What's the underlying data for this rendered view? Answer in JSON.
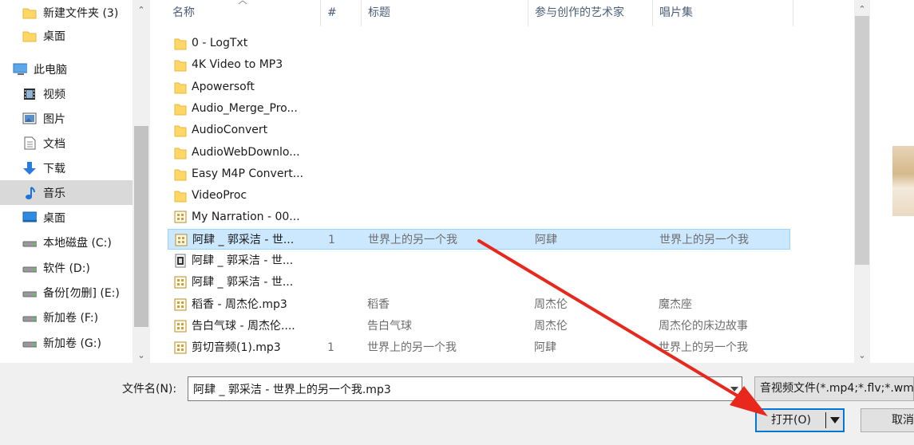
{
  "nav": {
    "items": [
      {
        "label": "新建文件夹 (3)",
        "icon": "folder-icon"
      },
      {
        "label": "桌面",
        "icon": "folder-icon"
      },
      {
        "label": "此电脑",
        "icon": "computer-icon"
      },
      {
        "label": "视频",
        "icon": "video-icon"
      },
      {
        "label": "图片",
        "icon": "picture-icon"
      },
      {
        "label": "文档",
        "icon": "document-icon"
      },
      {
        "label": "下载",
        "icon": "download-icon"
      },
      {
        "label": "音乐",
        "icon": "music-icon",
        "selected": true
      },
      {
        "label": "桌面",
        "icon": "desktop-icon"
      },
      {
        "label": "本地磁盘 (C:)",
        "icon": "drive-icon"
      },
      {
        "label": "软件 (D:)",
        "icon": "drive-icon"
      },
      {
        "label": "备份[勿删] (E:)",
        "icon": "drive-icon"
      },
      {
        "label": "新加卷 (F:)",
        "icon": "drive-icon"
      },
      {
        "label": "新加卷 (G:)",
        "icon": "drive-icon"
      }
    ]
  },
  "columns": {
    "name": "名称",
    "number": "#",
    "title": "标题",
    "artist": "参与创作的艺术家",
    "album": "唱片集"
  },
  "files": [
    {
      "name": "0 - LogTxt",
      "type": "folder",
      "number": "",
      "title": "",
      "artist": "",
      "album": ""
    },
    {
      "name": "4K Video to MP3",
      "type": "folder",
      "number": "",
      "title": "",
      "artist": "",
      "album": ""
    },
    {
      "name": "Apowersoft",
      "type": "folder",
      "number": "",
      "title": "",
      "artist": "",
      "album": ""
    },
    {
      "name": "Audio_Merge_Pro...",
      "type": "folder",
      "number": "",
      "title": "",
      "artist": "",
      "album": ""
    },
    {
      "name": "AudioConvert",
      "type": "folder",
      "number": "",
      "title": "",
      "artist": "",
      "album": ""
    },
    {
      "name": "AudioWebDownlo...",
      "type": "folder",
      "number": "",
      "title": "",
      "artist": "",
      "album": ""
    },
    {
      "name": "Easy M4P Convert...",
      "type": "folder",
      "number": "",
      "title": "",
      "artist": "",
      "album": ""
    },
    {
      "name": "VideoProc",
      "type": "folder",
      "number": "",
      "title": "",
      "artist": "",
      "album": ""
    },
    {
      "name": "My Narration - 00...",
      "type": "audio",
      "number": "",
      "title": "",
      "artist": "",
      "album": ""
    },
    {
      "name": "阿肆 _ 郭采洁 - 世...",
      "type": "audio",
      "number": "1",
      "title": "世界上的另一个我",
      "artist": "阿肆",
      "album": "世界上的另一个我",
      "selected": true
    },
    {
      "name": "阿肆 _ 郭采洁 - 世...",
      "type": "media",
      "number": "",
      "title": "",
      "artist": "",
      "album": ""
    },
    {
      "name": "阿肆 _ 郭采洁 - 世...",
      "type": "audio",
      "number": "",
      "title": "",
      "artist": "",
      "album": ""
    },
    {
      "name": "稻香 - 周杰伦.mp3",
      "type": "audio",
      "number": "",
      "title": "稻香",
      "artist": "周杰伦",
      "album": "魔杰座"
    },
    {
      "name": "告白气球 - 周杰伦....",
      "type": "audio",
      "number": "",
      "title": "告白气球",
      "artist": "周杰伦",
      "album": "周杰伦的床边故事"
    },
    {
      "name": "剪切音频(1).mp3",
      "type": "audio",
      "number": "1",
      "title": "世界上的另一个我",
      "artist": "阿肆",
      "album": "世界上的另一个我"
    }
  ],
  "filename": {
    "label": "文件名(N):",
    "value": "阿肆 _ 郭采洁 - 世界上的另一个我.mp3"
  },
  "filter": {
    "value": "音视频文件(*.mp4;*.flv;*.wm"
  },
  "buttons": {
    "open": "打开(O)",
    "cancel": "取消"
  },
  "annotation_color": "#e8281c"
}
